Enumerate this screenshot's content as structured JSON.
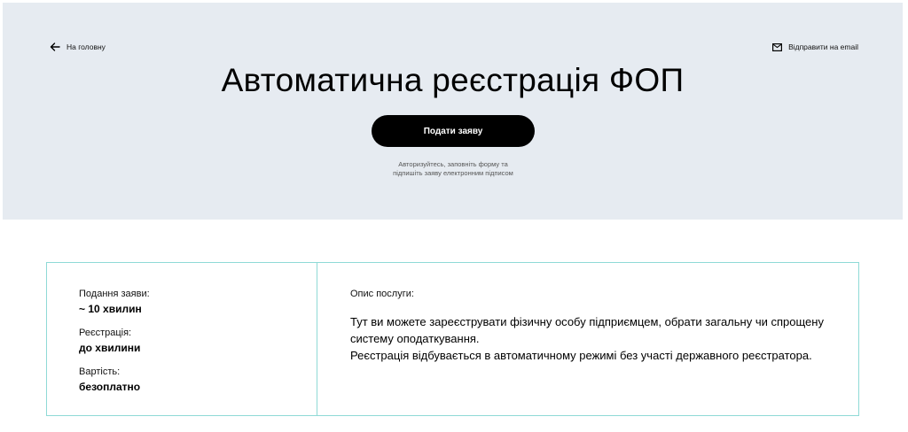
{
  "header": {
    "back_label": "На головну",
    "email_label": "Відправити на email",
    "title": "Автоматична реєстрація ФОП",
    "submit_label": "Подати заяву",
    "hint_line1": "Авторизуйтесь, заповніть форму та",
    "hint_line2": "підпишіть заяву електронним підписом"
  },
  "stats": [
    {
      "label": "Подання заяви:",
      "value": "~ 10 хвилин"
    },
    {
      "label": "Реєстрація:",
      "value": "до хвилини"
    },
    {
      "label": "Вартість:",
      "value": "безоплатно"
    }
  ],
  "description": {
    "label": "Опис послуги:",
    "paragraph1": "Тут ви можете зареєструвати фізичну особу підприємцем, обрати загальну чи спрощену систему оподаткування.",
    "paragraph2": "Реєстрація відбувається в автоматичному режимі без участі державного реєстратора."
  },
  "icons": {
    "back": "arrow-left-icon",
    "email": "envelope-icon"
  },
  "colors": {
    "hero_bg": "#e6ebf1",
    "button_bg": "#000000",
    "card_border": "#8fdad6"
  }
}
